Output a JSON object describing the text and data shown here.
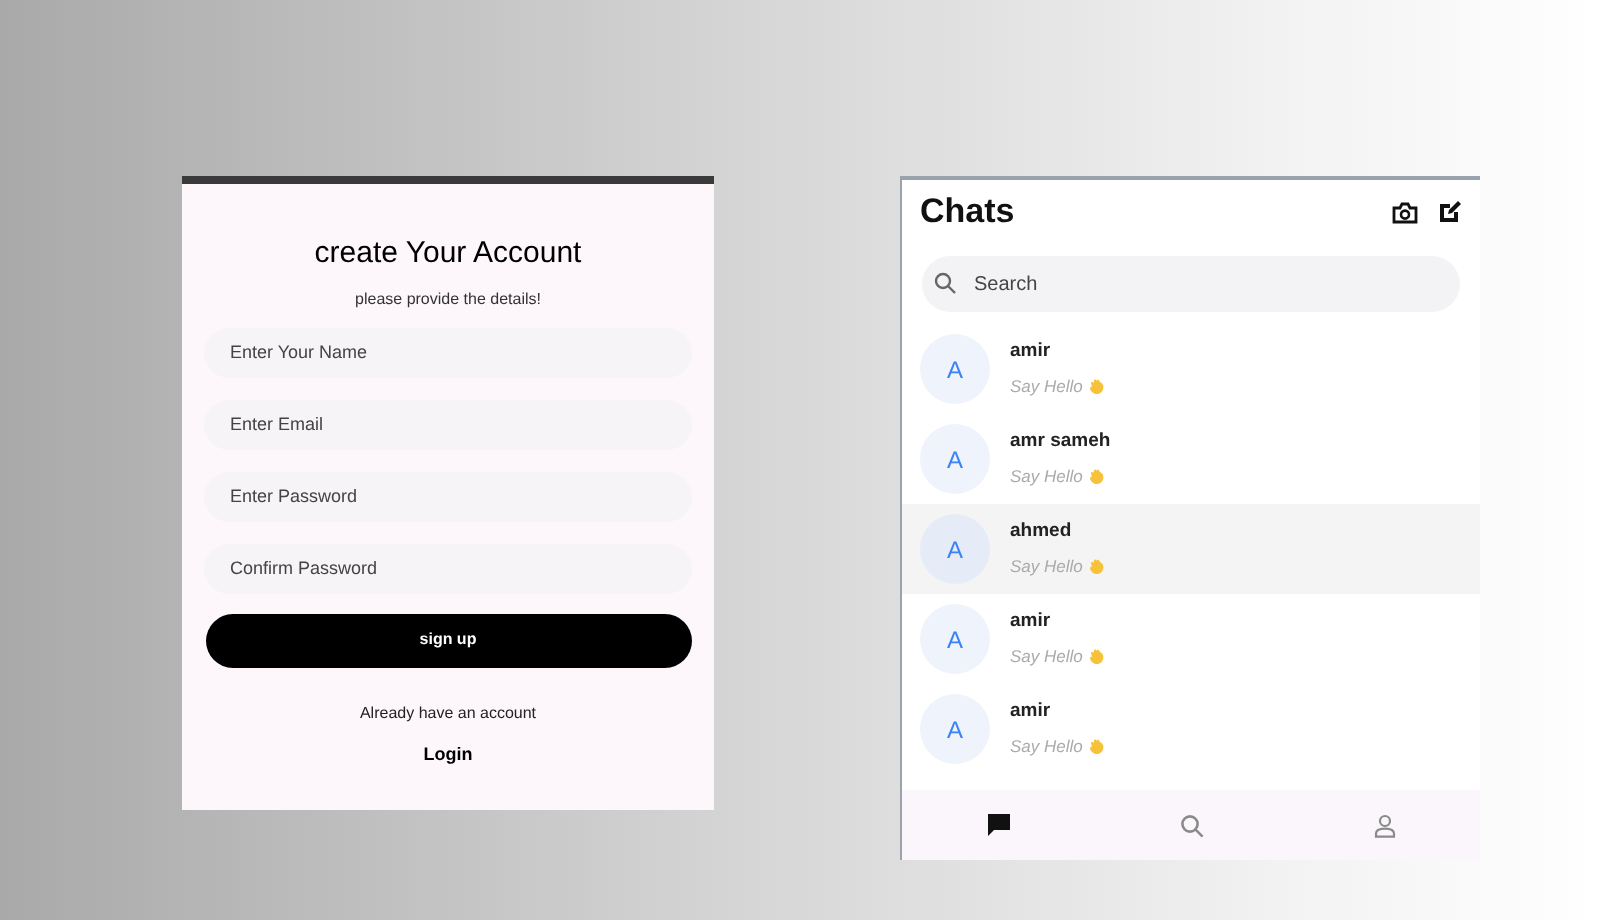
{
  "signup": {
    "title": "create Your Account",
    "subtitle": "please provide the details!",
    "fields": [
      {
        "placeholder": "Enter Your Name"
      },
      {
        "placeholder": "Enter Email"
      },
      {
        "placeholder": "Enter Password"
      },
      {
        "placeholder": "Confirm Password"
      }
    ],
    "button": "sign up",
    "prompt": "Already have an account",
    "link": "Login"
  },
  "chats": {
    "title": "Chats",
    "search": {
      "placeholder": "Search"
    },
    "rows": [
      {
        "initial": "A",
        "name": "amir",
        "message": "Say Hello",
        "selected": false
      },
      {
        "initial": "A",
        "name": "amr sameh",
        "message": "Say Hello",
        "selected": false
      },
      {
        "initial": "A",
        "name": "ahmed",
        "message": "Say Hello",
        "selected": true
      },
      {
        "initial": "A",
        "name": "amir",
        "message": "Say Hello",
        "selected": false
      },
      {
        "initial": "A",
        "name": "amir",
        "message": "Say Hello",
        "selected": false
      }
    ],
    "nav": [
      {
        "kind": "chats",
        "selected": true
      },
      {
        "kind": "search",
        "selected": false
      },
      {
        "kind": "profile",
        "selected": false
      }
    ]
  }
}
